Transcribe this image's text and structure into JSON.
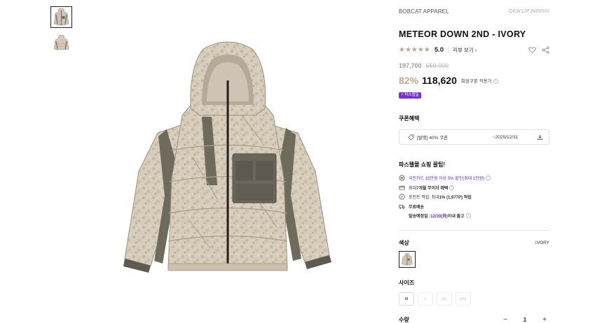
{
  "brand": "BOBCAT APPAREL",
  "product_code": "QKW1JPJN005IV",
  "title": "METEOR DOWN 2ND - IVORY",
  "rating": {
    "stars": "★★★★★",
    "score": "5.0",
    "review_link": "리뷰 보기 ›"
  },
  "price": {
    "original": "197,700",
    "strike": "659,000",
    "discount": "82%",
    "final": "118,620",
    "coupon_note": "회원쿠폰 적용가",
    "badge": "⚡ 파스앱딜"
  },
  "coupon": {
    "title": "쿠폰혜택",
    "name": "[발렛] 40% 쿠폰",
    "date": "~2025/12/31"
  },
  "tips": {
    "title": "파스텔몰 쇼핑 꿀팁!",
    "card_prefix": "국민카드 15만원 이상 5% 할인(최대 1만원)",
    "installment_a": "최대 ",
    "installment_b": "7개월 무이자 혜택",
    "points_a": "포인트 적립: 최대 ",
    "points_b": "1% (1,977P) 적립",
    "shipping": "무료배송",
    "ship_date_a": "발송예정일 : ",
    "ship_date_b": "12/30(화)",
    "ship_date_c": " 이내 출고"
  },
  "options": {
    "color_label": "색상",
    "color_value": "IVORY",
    "size_label": "사이즈",
    "sizes": [
      "M",
      "L",
      "XL",
      "XXL"
    ],
    "qty_label": "수량",
    "qty_minus": "−",
    "qty_value": "1",
    "qty_plus": "+"
  },
  "colors": {
    "accent": "#c7a68a",
    "purple": "#6a27c8",
    "badge": "#7b2ee0",
    "stars": "#b8a596"
  }
}
